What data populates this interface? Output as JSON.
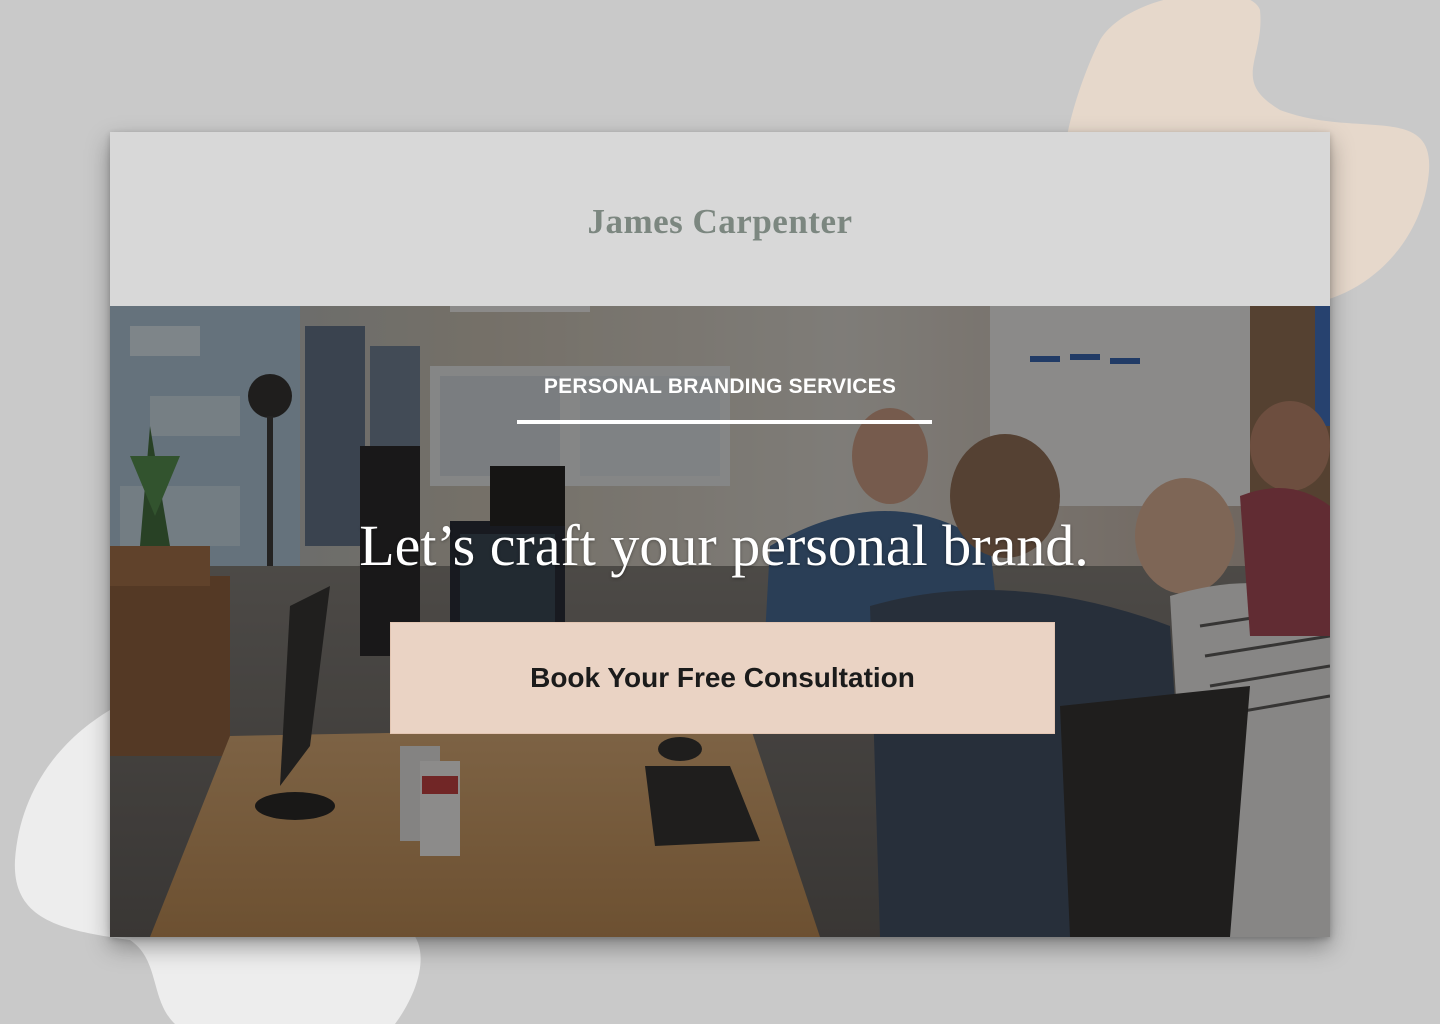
{
  "site": {
    "brand_name": "James Carpenter"
  },
  "hero": {
    "eyebrow": "PERSONAL BRANDING SERVICES",
    "headline": "Let’s craft your personal brand.",
    "cta_label": "Book Your Free Consultation"
  },
  "colors": {
    "page_background": "#c9c9c9",
    "header_background": "#d8d8d8",
    "brand_name_color": "#7c8780",
    "cta_background": "#ead3c4",
    "blob_peach": "#e6d8cb",
    "blob_white": "#ededed",
    "headline_color": "#ffffff"
  },
  "hero_photo": {
    "description_icon": "office-team-photo"
  }
}
